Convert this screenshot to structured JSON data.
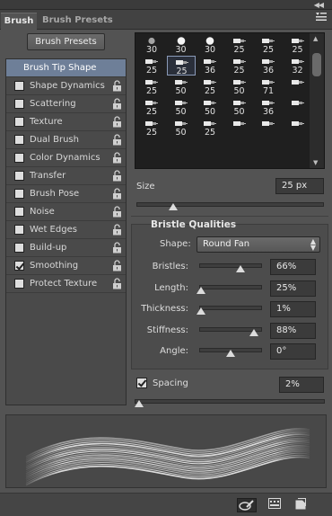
{
  "panel": {
    "collapse_icon": "double-arrow-icon",
    "menu_icon": "panel-menu-icon"
  },
  "tabs": [
    {
      "label": "Brush"
    },
    {
      "label": "Brush Presets"
    }
  ],
  "presets_button": "Brush Presets",
  "options": [
    {
      "label": "Brush Tip Shape",
      "selected": true
    },
    {
      "label": "Shape Dynamics",
      "checked": false
    },
    {
      "label": "Scattering",
      "checked": false
    },
    {
      "label": "Texture",
      "checked": false
    },
    {
      "label": "Dual Brush",
      "checked": false
    },
    {
      "label": "Color Dynamics",
      "checked": false
    },
    {
      "label": "Transfer",
      "checked": false
    },
    {
      "label": "Brush Pose",
      "checked": false
    },
    {
      "label": "Noise",
      "checked": false
    },
    {
      "label": "Wet Edges",
      "checked": false
    },
    {
      "label": "Build-up",
      "checked": false
    },
    {
      "label": "Smoothing",
      "checked": true
    },
    {
      "label": "Protect Texture",
      "checked": false
    }
  ],
  "tips": [
    [
      "30",
      "30",
      "30",
      "25",
      "25",
      "25"
    ],
    [
      "25",
      "25",
      "36",
      "25",
      "36",
      "32"
    ],
    [
      "25",
      "50",
      "25",
      "50",
      "71",
      ""
    ],
    [
      "25",
      "50",
      "50",
      "50",
      "36",
      ""
    ],
    [
      "25",
      "50",
      "25",
      "",
      "",
      ""
    ]
  ],
  "size": {
    "label": "Size",
    "value": "25 px",
    "fraction": 0.2
  },
  "bristle": {
    "title": "Bristle Qualities",
    "shape_label": "Shape:",
    "shape_value": "Round Fan",
    "rows": [
      {
        "label": "Bristles:",
        "value": "66%",
        "fraction": 0.66
      },
      {
        "label": "Length:",
        "value": "25%",
        "fraction": 0.02
      },
      {
        "label": "Thickness:",
        "value": "1%",
        "fraction": 0.01
      },
      {
        "label": "Stiffness:",
        "value": "88%",
        "fraction": 0.88
      },
      {
        "label": "Angle:",
        "value": "0°",
        "fraction": 0.5
      }
    ]
  },
  "spacing": {
    "label": "Spacing",
    "value": "2%",
    "checked": true,
    "fraction": 0.01
  },
  "footer_icons": [
    "toggle-live-tip-icon",
    "brush-grid-icon",
    "new-preset-icon"
  ],
  "colors": {
    "panel_bg": "#535353",
    "selected_bg": "#6e7f98",
    "tip_bg": "#1f1f1f"
  }
}
